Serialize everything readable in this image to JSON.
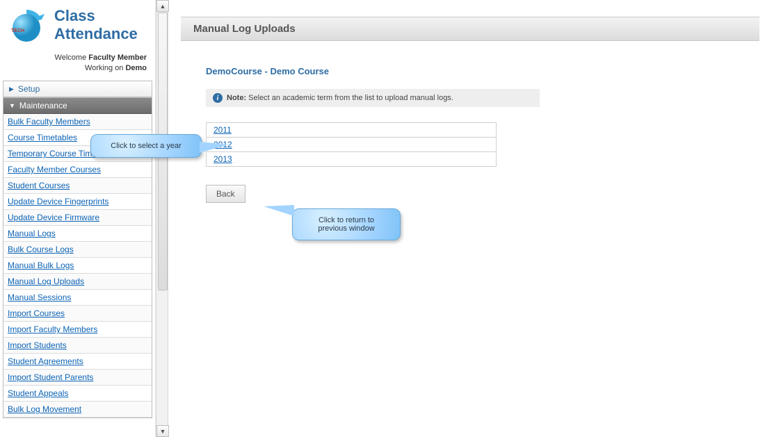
{
  "brand": {
    "title_line1": "Class",
    "title_line2": "Attendance",
    "logo_text": "TECH"
  },
  "welcome": {
    "prefix": "Welcome ",
    "role": "Faculty Member",
    "working_prefix": "Working on ",
    "working_on": "Demo"
  },
  "sidebar": {
    "setup_label": "Setup",
    "maintenance_label": "Maintenance",
    "items": [
      {
        "label": "Bulk Faculty Members"
      },
      {
        "label": "Course Timetables"
      },
      {
        "label": "Temporary Course Timetables"
      },
      {
        "label": "Faculty Member Courses"
      },
      {
        "label": "Student Courses"
      },
      {
        "label": "Update Device Fingerprints"
      },
      {
        "label": "Update Device Firmware"
      },
      {
        "label": "Manual Logs"
      },
      {
        "label": "Bulk Course Logs"
      },
      {
        "label": "Manual Bulk Logs"
      },
      {
        "label": "Manual Log Uploads"
      },
      {
        "label": "Manual Sessions"
      },
      {
        "label": "Import Courses"
      },
      {
        "label": "Import Faculty Members"
      },
      {
        "label": "Import Students"
      },
      {
        "label": "Student Agreements"
      },
      {
        "label": "Import Student Parents"
      },
      {
        "label": "Student Appeals"
      },
      {
        "label": "Bulk Log Movement"
      }
    ]
  },
  "page": {
    "title": "Manual Log Uploads",
    "course_heading": "DemoCourse - Demo Course",
    "note_prefix": "Note:",
    "note_text": " Select an academic term from the list to upload manual logs.",
    "years": [
      "2011",
      "2012",
      "2013"
    ],
    "back_label": "Back"
  },
  "callouts": {
    "select_year": "Click to select a year",
    "back": "Click to return to previous window"
  }
}
